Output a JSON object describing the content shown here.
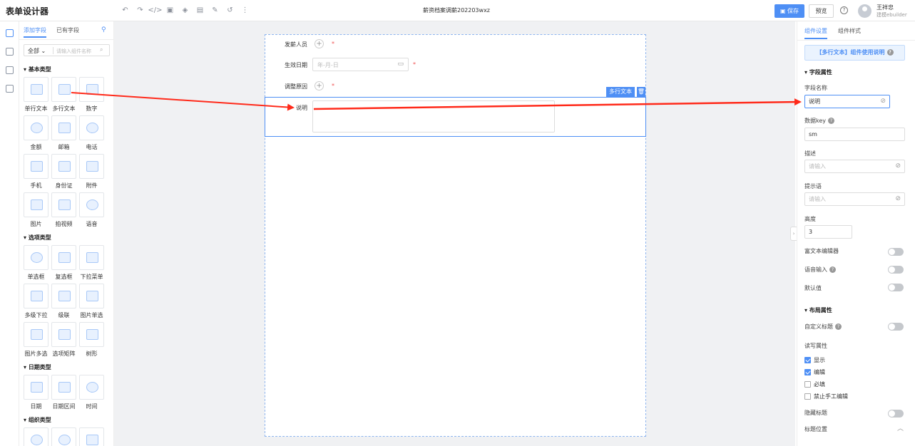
{
  "header": {
    "app_title": "表单设计器",
    "doc_title": "薪资档案调薪202203wxz",
    "save_label": "保存",
    "preview_label": "预览",
    "user_name": "王祥忠",
    "user_org": "建模ebuilder"
  },
  "toolbar_icons": [
    "undo-icon",
    "redo-icon",
    "code-icon",
    "image-icon",
    "layers-icon",
    "form-icon",
    "edit-icon",
    "history-icon",
    "more-icon"
  ],
  "left": {
    "tab_add": "添加字段",
    "tab_existing": "已有字段",
    "filter_value": "全部",
    "search_placeholder": "请输入组件名称",
    "sections": [
      {
        "title": "基本类型",
        "items": [
          "单行文本",
          "多行文本",
          "数字",
          "金额",
          "邮箱",
          "电话",
          "手机",
          "身份证",
          "附件",
          "图片",
          "拍视频",
          "语音"
        ]
      },
      {
        "title": "选项类型",
        "items": [
          "单选框",
          "复选框",
          "下拉菜单",
          "多级下拉",
          "级联",
          "图片单选",
          "图片多选",
          "选项矩阵",
          "树形"
        ]
      },
      {
        "title": "日期类型",
        "items": [
          "日期",
          "日期区间",
          "时间"
        ]
      },
      {
        "title": "组织类型",
        "items": []
      }
    ]
  },
  "form": {
    "field1_label": "发薪人员",
    "field2_label": "生效日期",
    "date_placeholder": "年-月-日",
    "field3_label": "调整原因",
    "field4_label": "说明",
    "badge_label": "多行文本",
    "required_mark": "*"
  },
  "right": {
    "tab_component": "组件设置",
    "tab_style": "组件样式",
    "notice": "【多行文本】组件使用说明",
    "field_props_head": "字段属性",
    "field_name_label": "字段名称",
    "field_name_value": "说明",
    "data_key_label": "数据key",
    "data_key_value": "sm",
    "desc_label": "描述",
    "desc_placeholder": "请输入",
    "hint_label": "提示语",
    "hint_placeholder": "请输入",
    "height_label": "高度",
    "height_value": "3",
    "rich_text_label": "富文本编辑器",
    "voice_input_label": "语音输入",
    "default_label": "默认值",
    "layout_props_head": "布局属性",
    "custom_title_label": "自定义标题",
    "rw_label": "读写属性",
    "cb_show": "显示",
    "cb_edit": "编辑",
    "cb_required": "必填",
    "cb_no_manual": "禁止手工编辑",
    "hide_title_label": "隐藏标题",
    "title_pos_label": "标题位置"
  },
  "colors": {
    "accent": "#4e8ff5",
    "required": "#f05050",
    "arrow": "#ff2a1a"
  }
}
